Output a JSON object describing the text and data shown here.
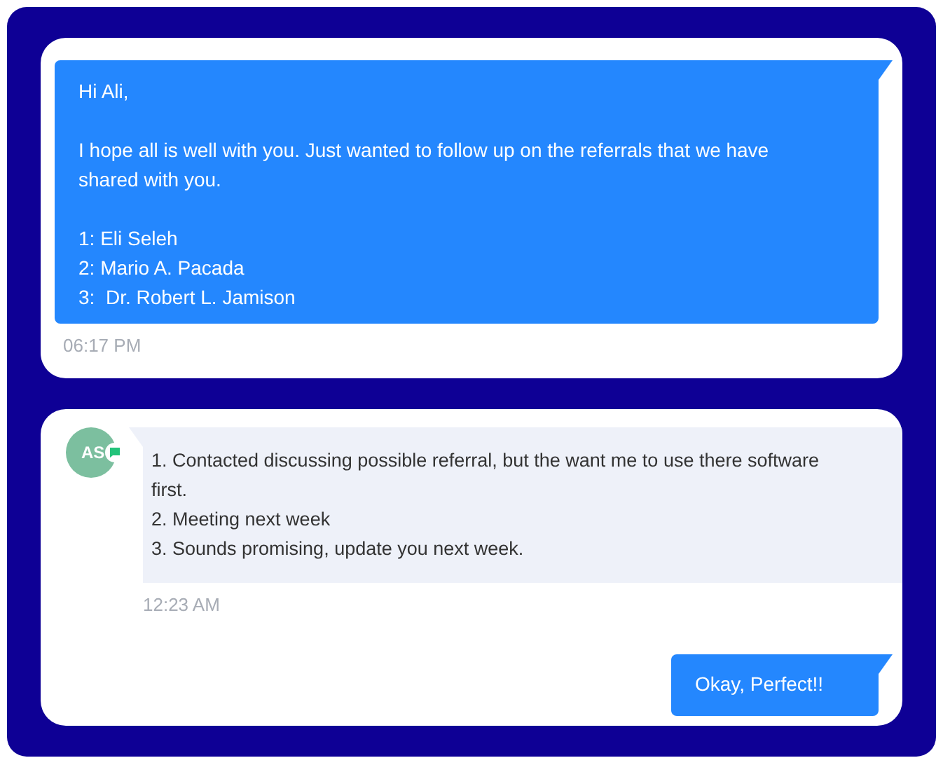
{
  "cards": [
    {
      "messages": [
        {
          "kind": "outgoing",
          "paragraphs": [
            [
              "Hi Ali,"
            ],
            [
              "I hope all is well with you. Just wanted to follow up on the referrals that we have shared with you."
            ],
            [
              "1: Eli Seleh",
              "2: Mario A. Pacada",
              "3:  Dr. Robert L. Jamison"
            ]
          ],
          "time": "06:17 PM"
        }
      ]
    },
    {
      "messages": [
        {
          "kind": "incoming",
          "avatar": "AS",
          "paragraphs": [
            [
              "1. Contacted discussing possible referral, but the want me to use there software first.",
              "2. Meeting next week",
              "3. Sounds promising, update you next week."
            ]
          ],
          "time": "12:23 AM"
        },
        {
          "kind": "outgoing",
          "paragraphs": [
            [
              "Okay, Perfect!!"
            ]
          ]
        }
      ]
    }
  ]
}
